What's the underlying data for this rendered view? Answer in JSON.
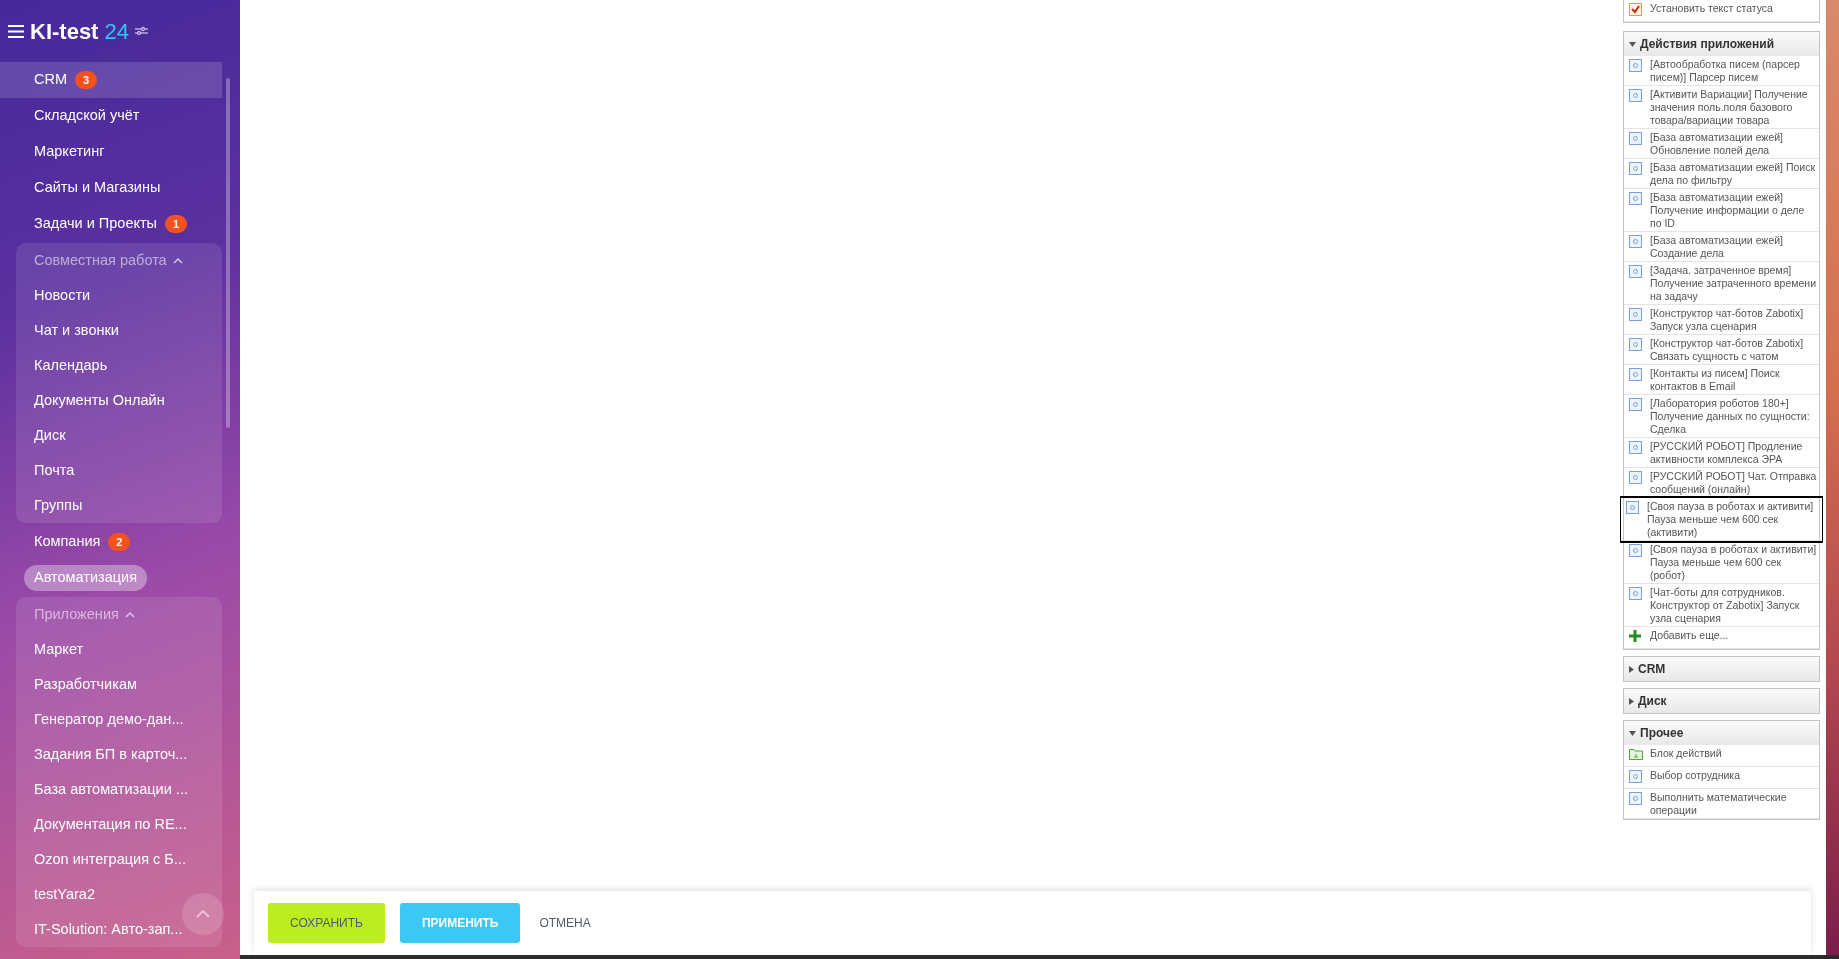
{
  "sidebar": {
    "logo": {
      "name": "KI-test",
      "suffix": "24"
    },
    "items": [
      {
        "kind": "link",
        "label": "CRM",
        "badge": "3",
        "hovered": true,
        "selected": false
      },
      {
        "kind": "link",
        "label": "Складской учёт",
        "hovered": false,
        "selected": false
      },
      {
        "kind": "link",
        "label": "Маркетинг",
        "hovered": false,
        "selected": false
      },
      {
        "kind": "link",
        "label": "Сайты и Магазины",
        "hovered": false,
        "selected": false
      },
      {
        "kind": "link",
        "label": "Задачи и Проекты",
        "badge": "1",
        "hovered": false,
        "selected": false
      },
      {
        "kind": "group",
        "label": "Совместная работа",
        "expanded": true,
        "children": [
          {
            "label": "Новости"
          },
          {
            "label": "Чат и звонки"
          },
          {
            "label": "Календарь"
          },
          {
            "label": "Документы Онлайн"
          },
          {
            "label": "Диск"
          },
          {
            "label": "Почта"
          },
          {
            "label": "Группы"
          }
        ]
      },
      {
        "kind": "link",
        "label": "Компания",
        "badge": "2",
        "hovered": false,
        "selected": false
      },
      {
        "kind": "link",
        "label": "Автоматизация",
        "hovered": false,
        "selected": true
      },
      {
        "kind": "group",
        "label": "Приложения",
        "expanded": true,
        "children": [
          {
            "label": "Маркет"
          },
          {
            "label": "Разработчикам"
          },
          {
            "label": "Генератор демо-дан..."
          },
          {
            "label": "Задания БП в карточ..."
          },
          {
            "label": "База автоматизации ..."
          },
          {
            "label": "Документация по RE..."
          },
          {
            "label": "Ozon интеграция с Б..."
          },
          {
            "label": "testYara2"
          },
          {
            "label": "IT-Solution: Авто-зап..."
          }
        ]
      }
    ]
  },
  "panel": {
    "sections": [
      {
        "expanded": true,
        "items": [
          {
            "kind": "status",
            "label": "Установить текст статуса",
            "selected": false
          }
        ]
      },
      {
        "title": "Действия приложений",
        "expanded": true,
        "items": [
          {
            "kind": "action",
            "label": "[Автообработка писем (парсер писем)] Парсер писем",
            "selected": false
          },
          {
            "kind": "action",
            "label": "[Активити Вариации] Получение значения поль.поля базового товара/вариации товара",
            "selected": false
          },
          {
            "kind": "action",
            "label": "[База автоматизации ежей] Обновление полей дела",
            "selected": false
          },
          {
            "kind": "action",
            "label": "[База автоматизации ежей] Поиск дела по фильтру",
            "selected": false
          },
          {
            "kind": "action",
            "label": "[База автоматизации ежей] Получение информации о деле по ID",
            "selected": false
          },
          {
            "kind": "action",
            "label": "[База автоматизации ежей] Создание дела",
            "selected": false
          },
          {
            "kind": "action",
            "label": "[Задача. затраченное время] Получение затраченного времени на задачу",
            "selected": false
          },
          {
            "kind": "action",
            "label": "[Конструктор чат-ботов Zabotix] Запуск узла сценария",
            "selected": false
          },
          {
            "kind": "action",
            "label": "[Конструктор чат-ботов Zabotix] Связать сущность с чатом",
            "selected": false
          },
          {
            "kind": "action",
            "label": "[Контакты из писем] Поиск контактов в Email",
            "selected": false
          },
          {
            "kind": "action",
            "label": "[Лаборатория роботов 180+] Получение данных по сущности: Сделка",
            "selected": false
          },
          {
            "kind": "action",
            "label": "[РУССКИЙ РОБОТ] Продление активности комплекса ЭРА",
            "selected": false
          },
          {
            "kind": "action",
            "label": "[РУССКИЙ РОБОТ] Чат. Отправка сообщений (онлайн)",
            "selected": false
          },
          {
            "kind": "action",
            "label": "[Своя пауза в роботах и активити] Пауза меньше чем 600 сек (активити)",
            "selected": true
          },
          {
            "kind": "action",
            "label": "[Своя пауза в роботах и активити] Пауза меньше чем 600 сек (робот)",
            "selected": false
          },
          {
            "kind": "action",
            "label": "[Чат-боты для сотрудников. Конструктор от Zabotix] Запуск узла сценария",
            "selected": false
          },
          {
            "kind": "add",
            "label": "Добавить еще...",
            "selected": false
          }
        ]
      },
      {
        "title": "CRM",
        "expanded": false
      },
      {
        "title": "Диск",
        "expanded": false
      },
      {
        "title": "Прочее",
        "expanded": true,
        "items": [
          {
            "kind": "block",
            "label": "Блок действий",
            "selected": false
          },
          {
            "kind": "action",
            "label": "Выбор сотрудника",
            "selected": false
          },
          {
            "kind": "action",
            "label": "Выполнить математические операции",
            "selected": false
          }
        ]
      }
    ]
  },
  "footer": {
    "buttons": [
      {
        "kind": "primary",
        "label": "СОХРАНИТЬ"
      },
      {
        "kind": "secondary",
        "label": "ПРИМЕНИТЬ"
      },
      {
        "kind": "link",
        "label": "ОТМЕНА"
      }
    ]
  }
}
